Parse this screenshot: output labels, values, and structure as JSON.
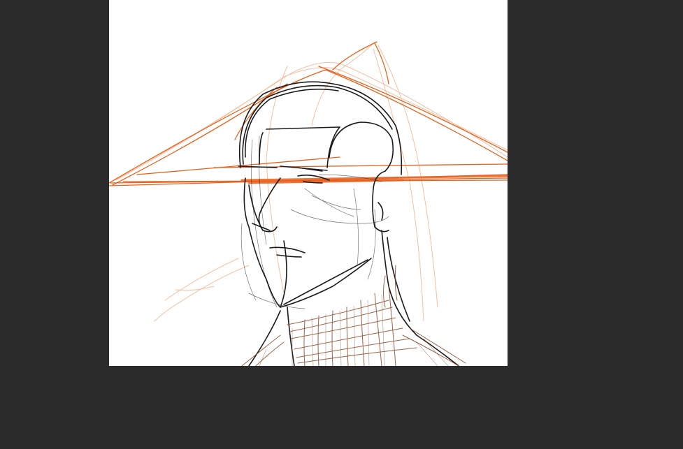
{
  "app": {
    "workspace_color": "#2b2b2b",
    "canvas_color": "#ffffff"
  },
  "artwork": {
    "subject": "",
    "ink_colors": [
      "#1a1a1a",
      "#e8601c",
      "#f0a070",
      "#8a4a2a"
    ]
  }
}
